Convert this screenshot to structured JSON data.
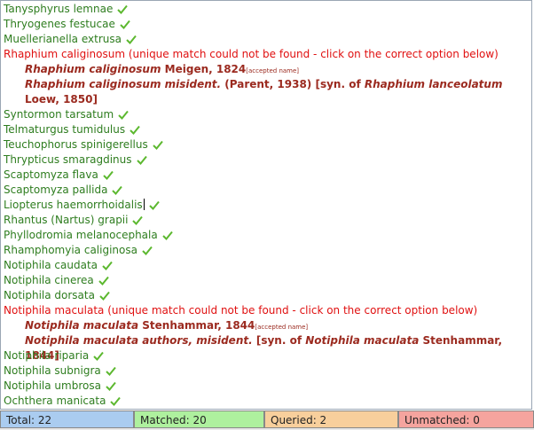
{
  "rows": {
    "r1": "Tanysphyrus lemnae",
    "r2": "Thryogenes festucae",
    "r3": "Muellerianella extrusa",
    "err1": "Rhaphium caliginosum (unique match could not be found - click on the correct option below)",
    "opt1a_name": "Rhaphium caliginosum",
    "opt1a_author": "Meigen, 1824",
    "opt1a_tag": "[accepted name]",
    "opt1b_name": "Rhaphium caliginosum misident.",
    "opt1b_author": "(Parent, 1938) [syn. of",
    "opt1b_syn": "Rhaphium lanceolatum",
    "opt1b_syn_author": "Loew, 1850]",
    "r4": "Syntormon tarsatum",
    "r5": "Telmaturgus tumidulus",
    "r6": "Teuchophorus spinigerellus",
    "r7": "Thrypticus smaragdinus",
    "r8": "Scaptomyza flava",
    "r9": "Scaptomyza pallida",
    "r10": "Liopterus haemorrhoidalis",
    "r11": "Rhantus (Nartus) grapii",
    "r12": "Phyllodromia melanocephala",
    "r13": "Rhamphomyia caliginosa",
    "r14": "Notiphila caudata",
    "r15": "Notiphila cinerea",
    "r16": "Notiphila dorsata",
    "err2": "Notiphila maculata (unique match could not be found - click on the correct option below)",
    "opt2a_name": "Notiphila maculata",
    "opt2a_author": "Stenhammar, 1844",
    "opt2a_tag": "[accepted name]",
    "opt2b_name": "Notiphila maculata authors, misident.",
    "opt2b_author": "[syn. of",
    "opt2b_syn": "Notiphila maculata",
    "opt2b_syn_author": "Stenhammar, 1844]",
    "r17": "Notiphila riparia",
    "r18": "Notiphila subnigra",
    "r19": "Notiphila umbrosa",
    "r20": "Ochthera manicata"
  },
  "status": {
    "total": "Total: 22",
    "matched": "Matched: 20",
    "queried": "Queried: 2",
    "unmatched": "Unmatched: 0"
  },
  "colors": {
    "matched_text": "#2e7d1f",
    "error_text": "#e01010",
    "option_text": "#9b2a1f",
    "total_bg": "#aaccf0",
    "matched_bg": "#aef09e",
    "queried_bg": "#f8cf9c",
    "unmatched_bg": "#f5a49e"
  },
  "icons": {
    "match": "check-icon"
  }
}
